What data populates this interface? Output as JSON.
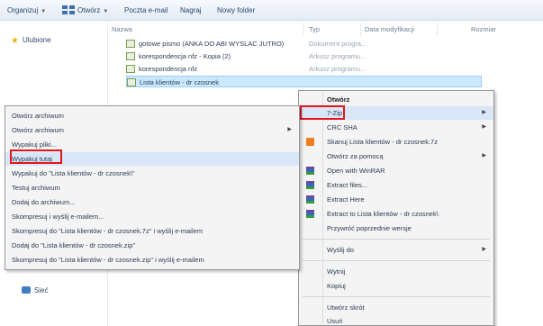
{
  "toolbar": {
    "organize": "Organizuj",
    "views": "Otwórz",
    "share": "Poczta e-mail",
    "burn": "Nagraj",
    "new_folder": "Nowy folder"
  },
  "nav": {
    "favorites": "Ulubione",
    "network": "Sieć"
  },
  "columns": {
    "name": "Nazwa",
    "type": "Typ",
    "date": "Data modyfikacji",
    "size": "Rozmiar"
  },
  "files": [
    {
      "name": "gotowe pismo (ANKA DO ABI WYSLAC JUTRO)",
      "type": "Dokument progra..."
    },
    {
      "name": "korespondencja nfz - Kopia (2)",
      "type": "Arkusz programu..."
    },
    {
      "name": "korespondencja nfz",
      "type": "Arkusz programu..."
    },
    {
      "name": "Lista klientów - dr czosnek",
      "type": ""
    }
  ],
  "menu_main": {
    "open": "Otwórz",
    "sevenzip": "7-Zip",
    "crc": "CRC SHA",
    "compress_7z": "Skanuj Lista klientów - dr czosnek.7z",
    "open_with": "Otwórz za pomocą",
    "open_winrar": "Open with WinRAR",
    "extract_files": "Extract files...",
    "extract_here": "Extract Here",
    "extract_to": "Extract to Lista klientów - dr czosnek\\",
    "restore": "Przywróć poprzednie wersje",
    "send_to": "Wyślij do",
    "cut": "Wytnij",
    "copy": "Kopiuj",
    "shortcut": "Utwórz skrót",
    "delete": "Usuń"
  },
  "menu_7zip": {
    "items": [
      "Otwórz archiwum",
      "Otwórz archiwum",
      "Wypakuj pliki...",
      "Wypakuj tutaj",
      "Wypakuj do \"Lista klientów - dr czosnek\\\"",
      "Testuj archiwum",
      "Dodaj do archiwum...",
      "Skompresuj i wyślij e-mailem...",
      "Skompresuj do \"Lista klientów - dr czosnek.7z\" i wyślij e-mailem",
      "Dodaj do \"Lista klientów - dr czosnek.zip\"",
      "Skompresuj do \"Lista klientów - dr czosnek.zip\" i wyślij e-mailem"
    ]
  },
  "icons": {
    "favorites": "star-icon",
    "network": "network-icon",
    "file": "spreadsheet-file-icon",
    "winrar": "winrar-icon",
    "sevenzip": "7zip-icon"
  },
  "colors": {
    "highlight_box": "#e3161b",
    "selection": "#cce8ff"
  }
}
